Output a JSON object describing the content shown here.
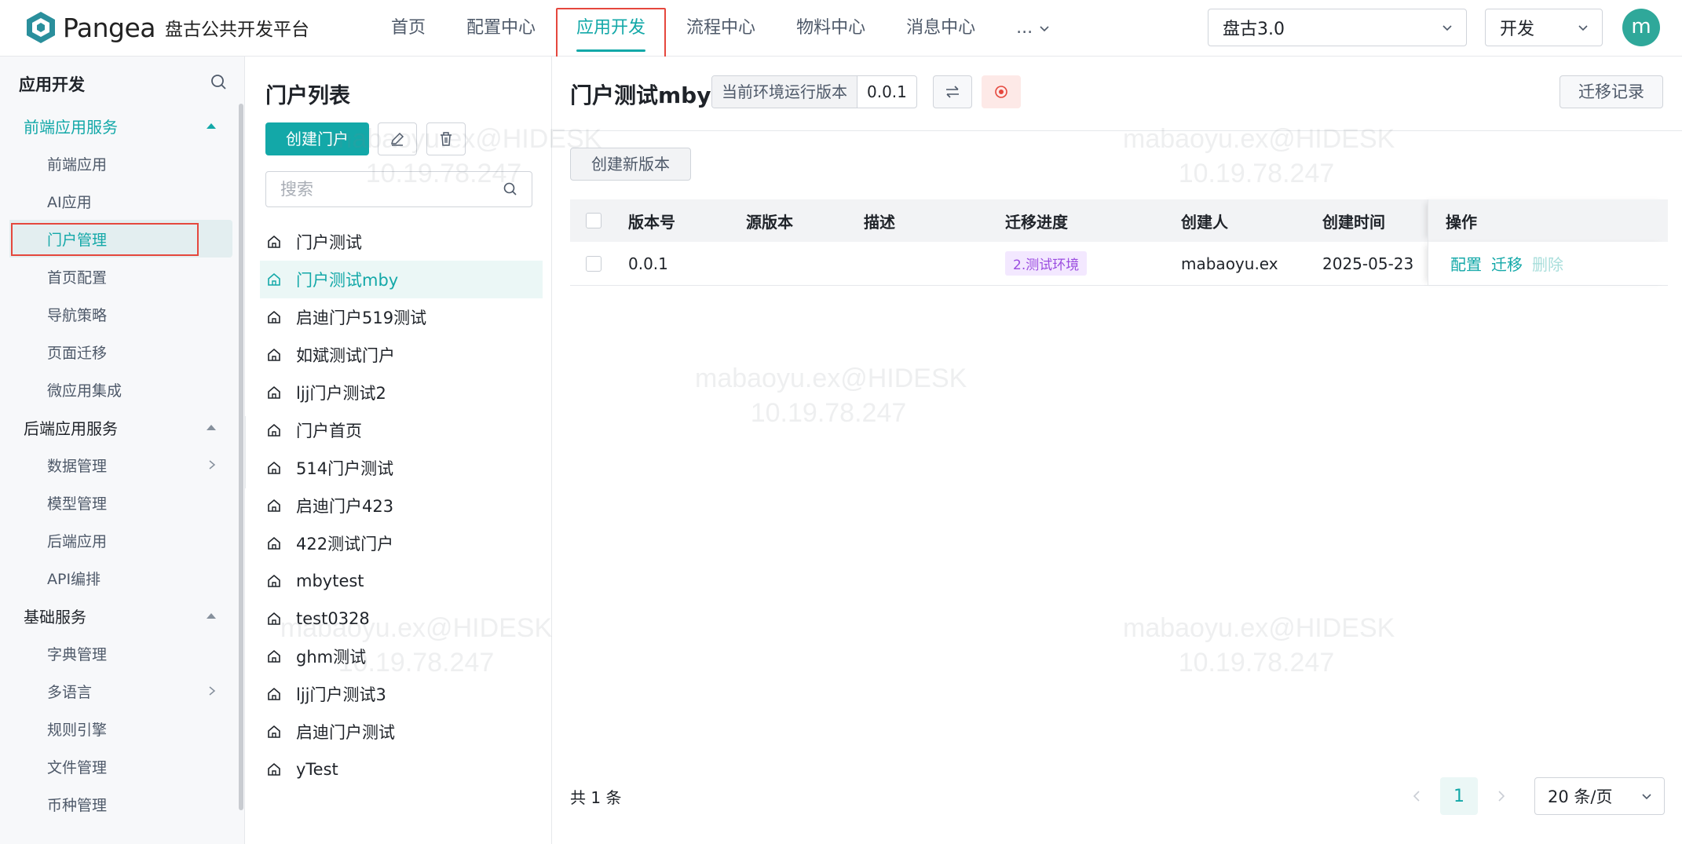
{
  "header": {
    "brand": "Pangea",
    "subtitle": "盘古公共开发平台",
    "nav": [
      "首页",
      "配置中心",
      "应用开发",
      "流程中心",
      "物料中心",
      "消息中心"
    ],
    "nav_more": "...",
    "project_select": "盘古3.0",
    "env_select": "开发",
    "avatar_letter": "m"
  },
  "sidebar": {
    "title": "应用开发",
    "groups": [
      {
        "label": "前端应用服务",
        "items": [
          "前端应用",
          "AI应用",
          "门户管理",
          "首页配置",
          "导航策略",
          "页面迁移",
          "微应用集成"
        ]
      },
      {
        "label": "后端应用服务",
        "items": [
          "数据管理",
          "模型管理",
          "后端应用",
          "API编排"
        ]
      },
      {
        "label": "基础服务",
        "items": [
          "字典管理",
          "多语言",
          "规则引擎",
          "文件管理",
          "币种管理"
        ]
      }
    ]
  },
  "portal_list": {
    "title": "门户列表",
    "create_label": "创建门户",
    "search_placeholder": "搜索",
    "items": [
      "门户测试",
      "门户测试mby",
      "启迪门户519测试",
      "如斌测试门户",
      "ljj门户测试2",
      "门户首页",
      "514门户测试",
      "启迪门户423",
      "422测试门户",
      "mbytest",
      "test0328",
      "ghm测试",
      "ljj门户测试3",
      "启迪门户测试",
      "yTest"
    ]
  },
  "main": {
    "title": "门户测试mby",
    "current_version_label": "当前环境运行版本",
    "current_version": "0.0.1",
    "history_label": "迁移记录",
    "new_version_label": "创建新版本",
    "columns": [
      "版本号",
      "源版本",
      "描述",
      "迁移进度",
      "创建人",
      "创建时间",
      "操作"
    ],
    "rows": [
      {
        "version": "0.0.1",
        "source": "",
        "desc": "",
        "progress": "2.测试环境",
        "creator": "mabaoyu.ex",
        "time": "2025-05-23",
        "ops": [
          "配置",
          "迁移",
          "删除"
        ]
      }
    ],
    "total": "共 1 条",
    "page": "1",
    "page_size": "20 条/页"
  },
  "watermark": {
    "line1": "mabaoyu.ex@HIDESK",
    "line2": "10.19.78.247"
  },
  "colors": {
    "accent": "#13a8a8",
    "highlight": "#e5473d",
    "tag_bg": "#f3e8ff",
    "tag_text": "#9b4de0"
  }
}
